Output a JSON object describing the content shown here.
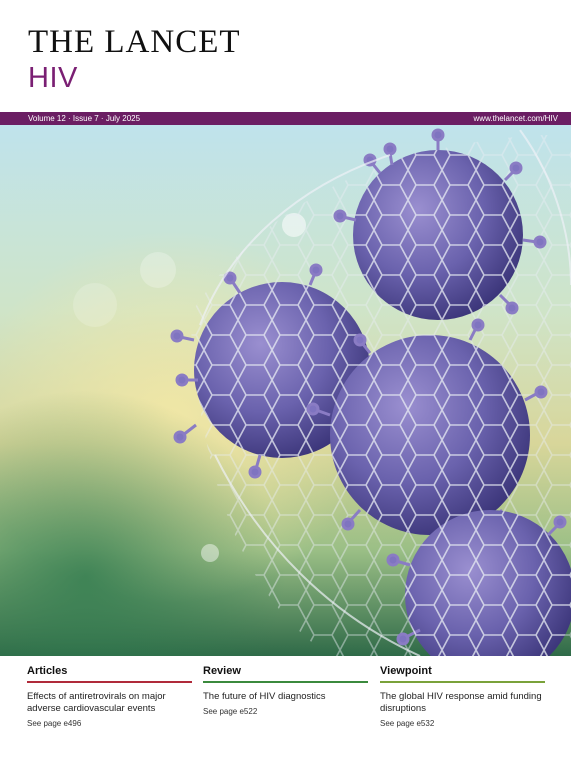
{
  "masthead": {
    "brand": "THE LANCET",
    "journal": "HIV"
  },
  "issue_band": {
    "issue": "Volume 12 · Issue 7 · July 2025",
    "url": "www.thelancet.com/HIV"
  },
  "cover_art": {
    "subject": "virus particles wrapped in a mesh net",
    "colors": {
      "virus": "#6a62ad",
      "band": "#6b1e63",
      "accent": "#7a1f73"
    }
  },
  "sections": [
    {
      "heading": "Articles",
      "title": "Effects of antiretrovirals on major adverse cardiovascular events",
      "see": "See page e496",
      "color": "#b02a3a"
    },
    {
      "heading": "Review",
      "title": "The future of HIV diagnostics",
      "see": "See page e522",
      "color": "#3b8a3d"
    },
    {
      "heading": "Viewpoint",
      "title": "The global HIV response amid funding disruptions",
      "see": "See page e532",
      "color": "#7aa23a"
    }
  ]
}
